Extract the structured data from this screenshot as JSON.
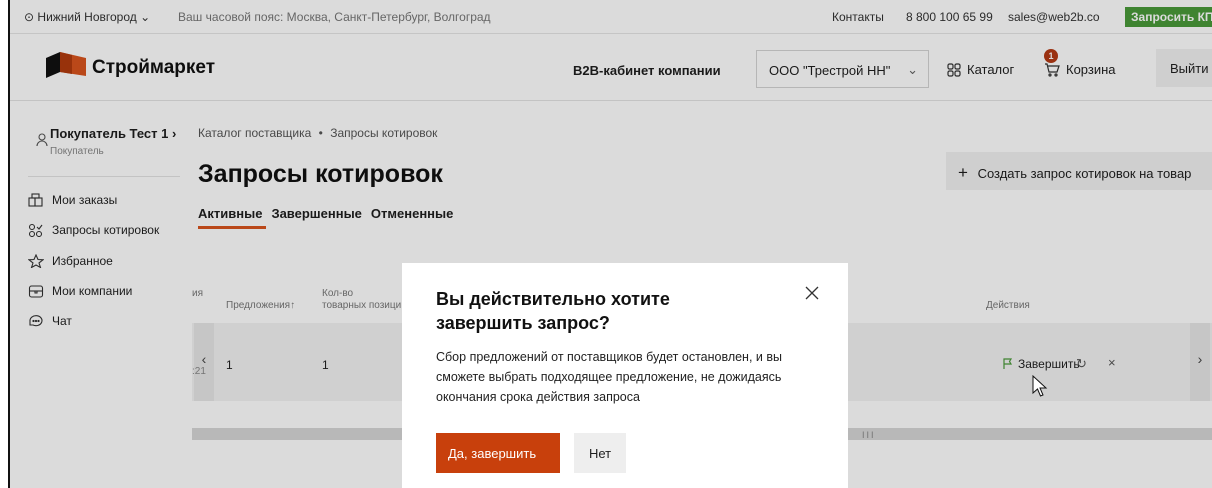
{
  "topbar": {
    "city": "Нижний Новгород",
    "timezone": "Ваш часовой пояс: Москва, Санкт-Петербург, Волгоград",
    "contacts": "Контакты",
    "phone": "8 800 100 65 99",
    "email": "sales@web2b.co",
    "request_kp": "Запросить КП"
  },
  "header": {
    "logo_text": "Строймаркет",
    "b2b_label": "B2B-кабинет компании",
    "org_select": "ООО \"Трестрой НН\"",
    "catalog": "Каталог",
    "cart": "Корзина",
    "cart_count": "1",
    "logout": "Выйти"
  },
  "sidebar": {
    "user_name": "Покупатель Тест 1 ›",
    "user_role": "Покупатель",
    "items": [
      {
        "label": "Мои заказы",
        "icon": "orders-icon"
      },
      {
        "label": "Запросы котировок",
        "icon": "quotes-icon"
      },
      {
        "label": "Избранное",
        "icon": "star-icon"
      },
      {
        "label": "Мои компании",
        "icon": "company-icon"
      },
      {
        "label": "Чат",
        "icon": "chat-icon"
      }
    ]
  },
  "main": {
    "breadcrumb_1": "Каталог поставщика",
    "breadcrumb_sep": "•",
    "breadcrumb_2": "Запросы котировок",
    "title": "Запросы котировок",
    "create_button": "Создать запрос котировок на товар",
    "tabs": [
      "Активные",
      "Завершенные",
      "Отмененные"
    ]
  },
  "table": {
    "col_partial": "ия",
    "col_offers": "Предложения↑",
    "col_items_1": "Кол-во",
    "col_items_2": "товарных позици",
    "col_actions": "Действия",
    "row_partial": ":21",
    "row_offers": "1",
    "row_items": "1",
    "finish_label": "Завершить"
  },
  "modal": {
    "title": "Вы действительно хотите завершить запрос?",
    "body": "Сбор предложений от поставщиков будет остановлен, и вы сможете выбрать подходящее предложение, не дожидаясь окончания срока действия запроса",
    "yes": "Да, завершить",
    "no": "Нет"
  },
  "colors": {
    "accent": "#c8400c",
    "kp_green": "#4a9a3a"
  }
}
